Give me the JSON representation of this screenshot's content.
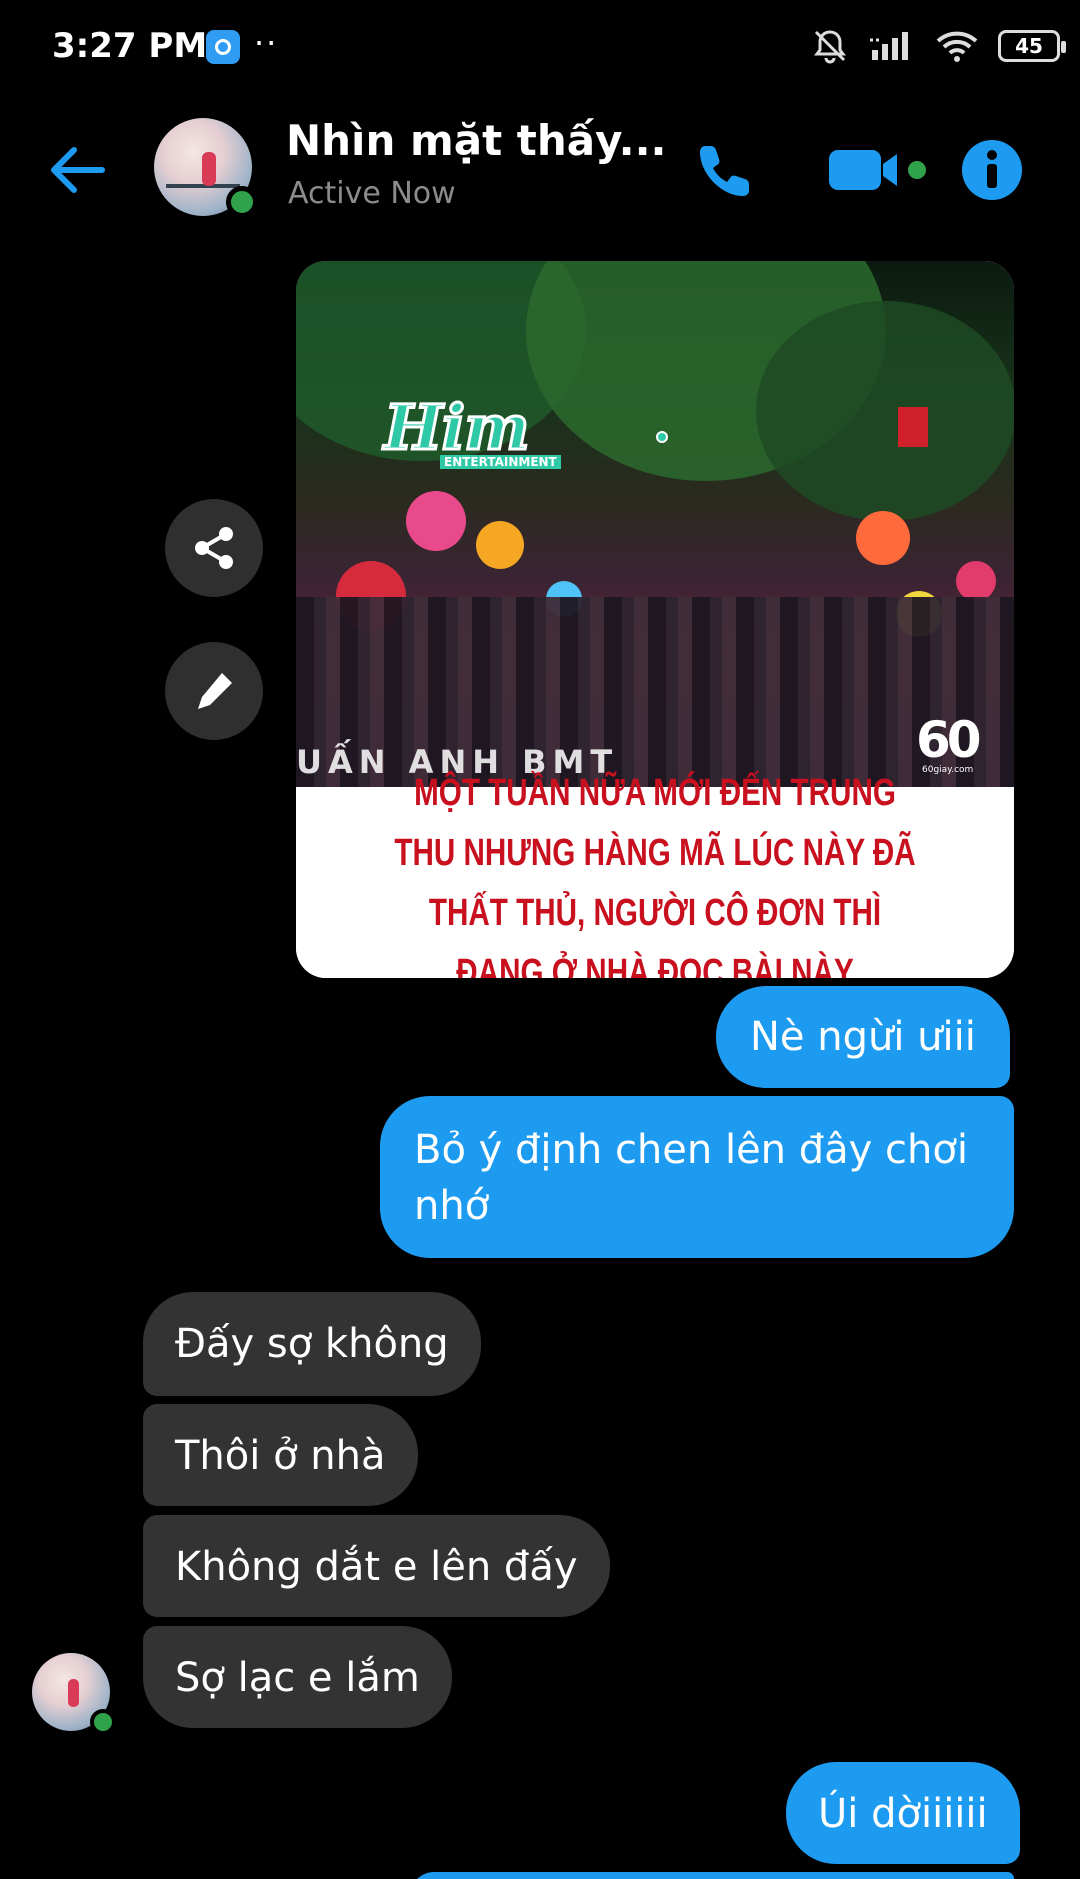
{
  "status_bar": {
    "time": "3:27 PM",
    "dots": "··",
    "battery": "45",
    "icons": [
      "messenger-app-icon",
      "bell-muted-icon",
      "signal-icon",
      "wifi-icon",
      "battery-icon"
    ]
  },
  "header": {
    "name": "Nhìn mặt thấy...",
    "status": "Active Now",
    "icons": [
      "back-arrow-icon",
      "phone-icon",
      "video-camera-icon",
      "info-icon"
    ],
    "accent_color": "#1d9bf0",
    "online_color": "#31a24c"
  },
  "shared_image": {
    "logo": "Him",
    "logo_sub": "ENTERTAINMENT",
    "watermark": "UẤN ANH BMT",
    "badge": "60",
    "badge_sub": "60giay.com",
    "caption": "MỘT TUẦN NỮA MỚI ĐẾN TRUNG THU NHƯNG HÀNG MÃ LÚC NÀY ĐÃ THẤT THỦ, NGƯỜI CÔ ĐƠN THÌ ĐANG Ở NHÀ ĐỌC BÀI NÀY",
    "caption_color": "#c8101e"
  },
  "side_actions": [
    "share-icon",
    "pencil-icon"
  ],
  "messages": [
    {
      "direction": "outgoing",
      "text": "Nè ngừi ưiii"
    },
    {
      "direction": "outgoing",
      "text": "Bỏ ý định chen lên đây chơi nhớ"
    },
    {
      "direction": "incoming",
      "text": "Đấy sợ không"
    },
    {
      "direction": "incoming",
      "text": "Thôi ở nhà"
    },
    {
      "direction": "incoming",
      "text": "Không dắt e lên đấy"
    },
    {
      "direction": "incoming",
      "text": "Sợ lạc e lắm"
    },
    {
      "direction": "outgoing",
      "text": "Úi dờiiiiii"
    },
    {
      "direction": "outgoing",
      "text": ""
    }
  ],
  "colors": {
    "background": "#000000",
    "outgoing_bubble": "#1d9bf0",
    "incoming_bubble": "#333333"
  }
}
